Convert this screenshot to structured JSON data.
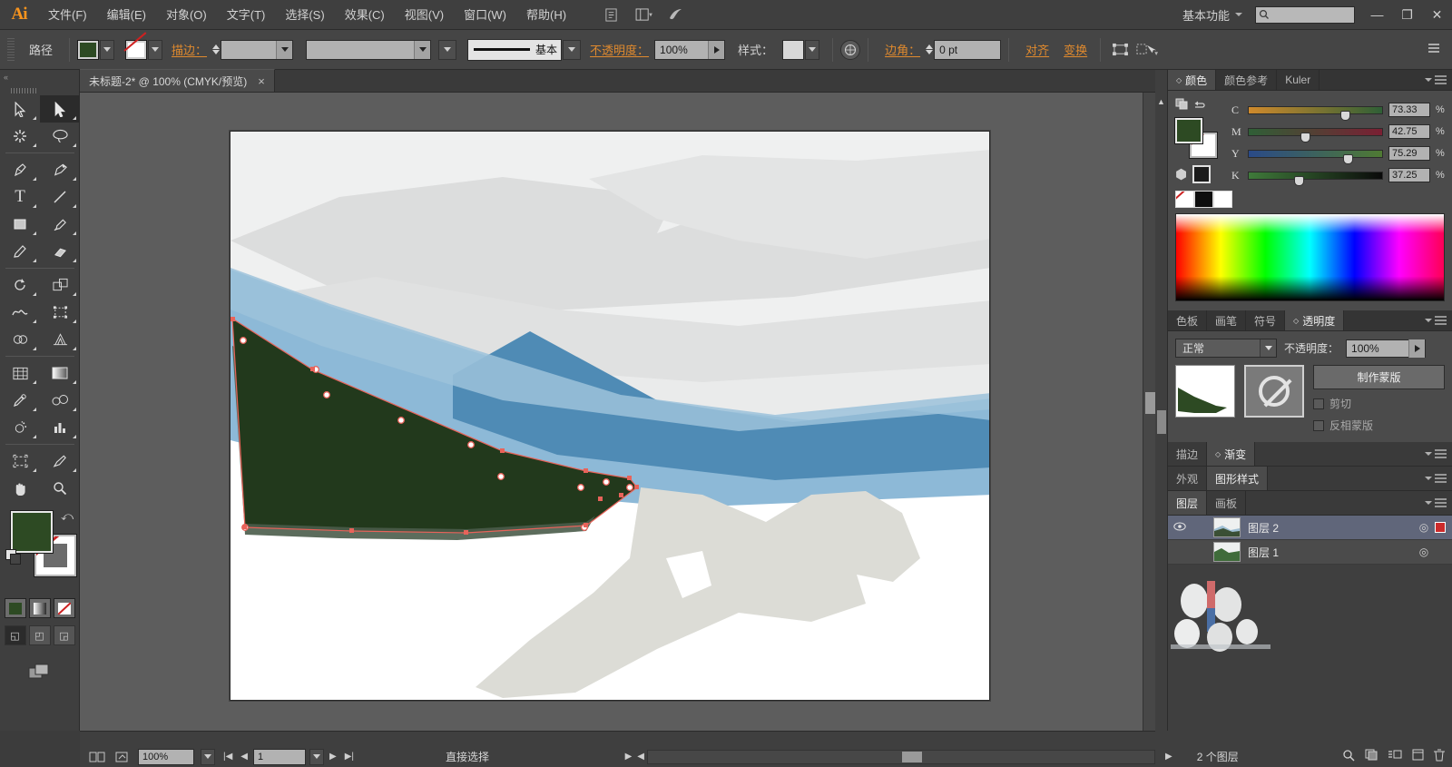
{
  "app": {
    "name": "Ai",
    "logo_text": "Ai"
  },
  "menubar": {
    "items": [
      {
        "label": "文件(F)"
      },
      {
        "label": "编辑(E)"
      },
      {
        "label": "对象(O)"
      },
      {
        "label": "文字(T)"
      },
      {
        "label": "选择(S)"
      },
      {
        "label": "效果(C)"
      },
      {
        "label": "视图(V)"
      },
      {
        "label": "窗口(W)"
      },
      {
        "label": "帮助(H)"
      }
    ],
    "bridge_icon": "bridge-icon",
    "arrange_icon": "arrange-documents-icon",
    "stock_icon": "adobe-stock-icon",
    "workspace": "基本功能",
    "search_placeholder": "",
    "search_icon": "search-icon",
    "window_buttons": {
      "minimize": "—",
      "restore": "❐",
      "close": "✕"
    }
  },
  "controlbar": {
    "selection_label": "路径",
    "fill_color": "#2d4a23",
    "stroke_label": "描边：",
    "stroke_color": "none",
    "stroke_weight": "",
    "stroke_profile": "",
    "brush_definition": "基本",
    "opacity_label": "不透明度：",
    "opacity_value": "100%",
    "style_label": "样式：",
    "recolor_icon": "recolor-artwork-icon",
    "corner_label": "边角：",
    "corner_value": "0 pt",
    "align_label": "对齐",
    "transform_label": "变换",
    "isolate_icon": "isolate-selected-icon",
    "select_similar_icon": "select-similar-icon",
    "panel_menu_icon": "panel-menu-icon"
  },
  "document_tab": {
    "title": "未标题-2* @ 100% (CMYK/预览)",
    "close": "×"
  },
  "toolbar": {
    "tools": [
      {
        "name": "selection-tool",
        "glyph": "➤",
        "active": false
      },
      {
        "name": "direct-selection-tool",
        "glyph": "➤",
        "active": true
      },
      {
        "name": "magic-wand-tool",
        "glyph": "✳",
        "active": false
      },
      {
        "name": "lasso-tool",
        "glyph": "◌",
        "active": false
      },
      {
        "name": "pen-tool",
        "glyph": "✒",
        "active": false
      },
      {
        "name": "curvature-tool",
        "glyph": "✒",
        "active": false
      },
      {
        "name": "type-tool",
        "glyph": "T",
        "active": false
      },
      {
        "name": "line-segment-tool",
        "glyph": "／",
        "active": false
      },
      {
        "name": "rectangle-tool",
        "glyph": "▢",
        "active": false
      },
      {
        "name": "paintbrush-tool",
        "glyph": "🖌",
        "active": false
      },
      {
        "name": "pencil-tool",
        "glyph": "✏",
        "active": false
      },
      {
        "name": "eraser-tool",
        "glyph": "▰",
        "active": false
      },
      {
        "name": "rotate-tool",
        "glyph": "↻",
        "active": false
      },
      {
        "name": "scale-tool",
        "glyph": "⧉",
        "active": false
      },
      {
        "name": "width-tool",
        "glyph": "∿",
        "active": false
      },
      {
        "name": "free-transform-tool",
        "glyph": "⬚",
        "active": false
      },
      {
        "name": "shape-builder-tool",
        "glyph": "◉",
        "active": false
      },
      {
        "name": "perspective-grid-tool",
        "glyph": "⊿",
        "active": false
      },
      {
        "name": "mesh-tool",
        "glyph": "▦",
        "active": false
      },
      {
        "name": "gradient-tool",
        "glyph": "▤",
        "active": false
      },
      {
        "name": "eyedropper-tool",
        "glyph": "⚲",
        "active": false
      },
      {
        "name": "blend-tool",
        "glyph": "◕",
        "active": false
      },
      {
        "name": "symbol-sprayer-tool",
        "glyph": "⚘",
        "active": false
      },
      {
        "name": "column-graph-tool",
        "glyph": "▥",
        "active": false
      },
      {
        "name": "artboard-tool",
        "glyph": "⌗",
        "active": false
      },
      {
        "name": "slice-tool",
        "glyph": "✂",
        "active": false
      },
      {
        "name": "hand-tool",
        "glyph": "✋",
        "active": false
      },
      {
        "name": "zoom-tool",
        "glyph": "🔍",
        "active": false
      }
    ],
    "fill_color": "#2d4a23",
    "stroke_color": "none",
    "swap_icon": "swap-fill-stroke-icon",
    "defaults_icon": "default-fill-stroke-icon",
    "fill_modes": [
      {
        "name": "color-mode-button",
        "selected": true
      },
      {
        "name": "gradient-mode-button",
        "selected": false
      },
      {
        "name": "none-mode-button",
        "selected": false
      }
    ],
    "screen_modes": [
      {
        "name": "normal-screen-mode",
        "glyph": "◱",
        "selected": true
      },
      {
        "name": "full-screen-menubar-mode",
        "glyph": "◰",
        "selected": false
      },
      {
        "name": "full-screen-mode",
        "glyph": "◲",
        "selected": false
      }
    ],
    "change_screen_icon": "change-screen-mode-icon"
  },
  "color_panel": {
    "tabs": [
      {
        "label": "颜色",
        "active": true
      },
      {
        "label": "颜色参考",
        "active": false
      },
      {
        "label": "Kuler",
        "active": false
      }
    ],
    "fill_color": "#2d4a23",
    "stroke_color": "none",
    "sliders": [
      {
        "label": "C",
        "value": "73.33",
        "unit": "%",
        "pct": 73.33,
        "gradient": "linear-gradient(to right,#d08a2c,#2f5f36)"
      },
      {
        "label": "M",
        "value": "42.75",
        "unit": "%",
        "pct": 42.75,
        "gradient": "linear-gradient(to right,#2f5f36,#7a1f33)"
      },
      {
        "label": "Y",
        "value": "75.29",
        "unit": "%",
        "pct": 75.29,
        "gradient": "linear-gradient(to right,#2a4a88,#4f7a33)"
      },
      {
        "label": "K",
        "value": "37.25",
        "unit": "%",
        "pct": 37.25,
        "gradient": "linear-gradient(to right,#3f7a3a,#0a0a0a)"
      }
    ],
    "none_label": "none-swatch",
    "black_label": "black-swatch",
    "white_label": "white-swatch"
  },
  "transparency_panel": {
    "tabs": [
      {
        "label": "色板",
        "active": false
      },
      {
        "label": "画笔",
        "active": false
      },
      {
        "label": "符号",
        "active": false
      },
      {
        "label": "透明度",
        "active": true
      }
    ],
    "blend_mode": "正常",
    "opacity_label": "不透明度：",
    "opacity_value": "100%",
    "make_mask_button": "制作蒙版",
    "clip_checkbox": "剪切",
    "invert_mask_checkbox": "反相蒙版"
  },
  "collapsed_panels": [
    {
      "tabs": [
        {
          "label": "描边",
          "active": false
        },
        {
          "label": "渐变",
          "active": true
        }
      ]
    },
    {
      "tabs": [
        {
          "label": "外观",
          "active": false
        },
        {
          "label": "图形样式",
          "active": true
        }
      ]
    },
    {
      "tabs": [
        {
          "label": "图层",
          "active": true
        },
        {
          "label": "画板",
          "active": false
        }
      ]
    }
  ],
  "layers_panel": {
    "rows": [
      {
        "name": "图层 2",
        "selected": true,
        "visible": true,
        "eye": "👁",
        "target": "◎",
        "has_selection_square": true
      },
      {
        "name": "图层 1",
        "selected": false,
        "visible": true,
        "eye": "",
        "target": "◎",
        "has_selection_square": false
      }
    ],
    "footer_count": "2 个图层",
    "footer_icons": [
      {
        "name": "locate-object-icon",
        "glyph": "🔍"
      },
      {
        "name": "make-clipping-mask-icon",
        "glyph": "▣"
      },
      {
        "name": "create-new-sublayer-icon",
        "glyph": "⊞"
      },
      {
        "name": "create-new-layer-icon",
        "glyph": "◳"
      },
      {
        "name": "delete-layer-icon",
        "glyph": "🗑"
      }
    ]
  },
  "statusbar": {
    "artboard_nav_icon": "artboard-navigation-icon",
    "export_icon": "share-on-behance-icon",
    "zoom_value": "100%",
    "page_value": "1",
    "current_tool": "直接选择",
    "first_icon": "first-artboard-icon",
    "prev_icon": "previous-artboard-icon",
    "next_icon": "next-artboard-icon",
    "last_icon": "last-artboard-icon"
  },
  "artwork": {
    "title": "landscape-vector-illustration",
    "colors": {
      "sky": "#eff0f0",
      "cloud_light": "#e3e4e4",
      "cloud_mid": "#dcdddd",
      "mountain_light_blue": "#8db9d7",
      "mountain_mid_blue": "#7fb0d0",
      "mountain_dark_blue": "#4f8bb5",
      "forest_green": "#22391c",
      "forest_green_shadow": "#4a5c4a",
      "shore_gray": "#dcdcd6",
      "white": "#ffffff"
    },
    "selection": {
      "anchor_stroke": "#e8635a",
      "anchor_fill": "#ffffff",
      "path_color": "#e8635a",
      "anchor_points": [
        [
          4,
          208
        ],
        [
          14,
          230
        ],
        [
          94,
          264
        ],
        [
          106,
          290
        ],
        [
          296,
          352
        ],
        [
          390,
          372
        ],
        [
          396,
          380
        ],
        [
          440,
          384
        ],
        [
          446,
          392
        ],
        [
          16,
          436
        ],
        [
          134,
          440
        ],
        [
          260,
          442
        ],
        [
          390,
          426
        ],
        [
          392,
          434
        ]
      ]
    }
  }
}
